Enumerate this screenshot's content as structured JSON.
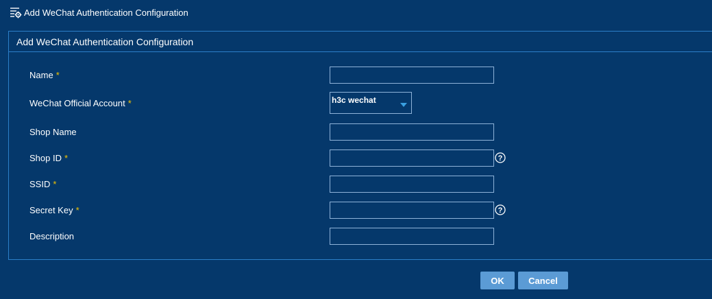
{
  "header": {
    "title": "Add WeChat Authentication Configuration",
    "icon": "list-settings-icon"
  },
  "panel": {
    "title": "Add WeChat Authentication Configuration"
  },
  "form": {
    "required_mark": "*",
    "name": {
      "label": "Name",
      "required": true,
      "value": ""
    },
    "wechat_account": {
      "label": "WeChat Official Account",
      "required": true,
      "value": "h3c wechat"
    },
    "shop_name": {
      "label": "Shop Name",
      "required": false,
      "value": ""
    },
    "shop_id": {
      "label": "Shop ID",
      "required": true,
      "value": "",
      "help_icon": "question-circle-icon"
    },
    "ssid": {
      "label": "SSID",
      "required": true,
      "value": ""
    },
    "secret_key": {
      "label": "Secret Key",
      "required": true,
      "value": "",
      "help_icon": "question-circle-icon"
    },
    "description": {
      "label": "Description",
      "required": false,
      "value": ""
    }
  },
  "buttons": {
    "ok": "OK",
    "cancel": "Cancel"
  },
  "colors": {
    "background": "#05386b",
    "border": "#2c7fc9",
    "input_border": "#8fb3d9",
    "required": "#f2c300",
    "button": "#5b9bd5",
    "dropdown_arrow": "#3aa0e0"
  }
}
